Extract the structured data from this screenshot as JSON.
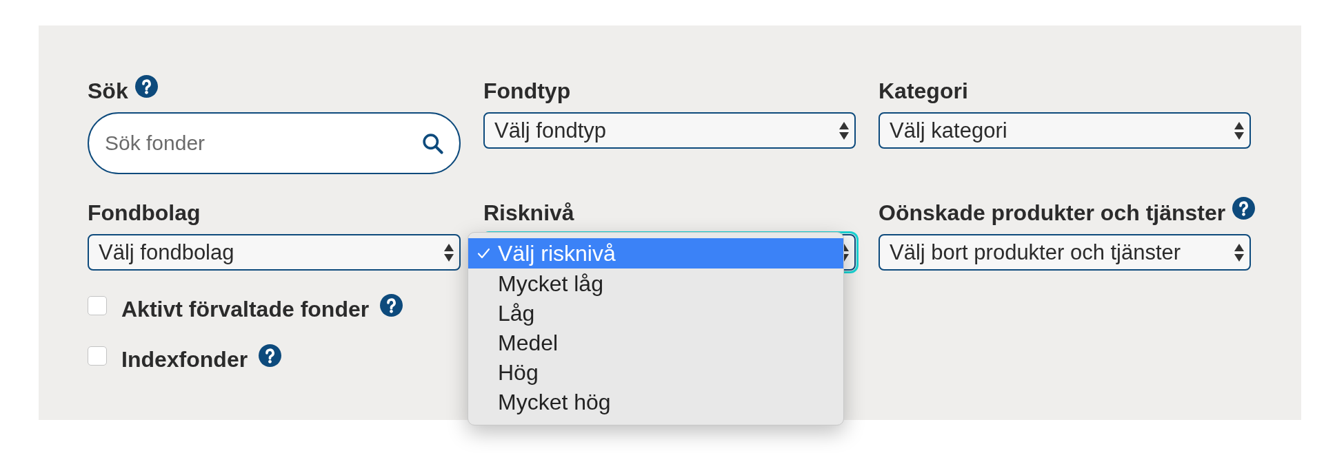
{
  "filters": [
    {
      "kind": "search",
      "label": "Sök",
      "help": true,
      "placeholder": "Sök fonder"
    },
    {
      "kind": "select",
      "label": "Fondtyp",
      "help": false,
      "value": "Välj fondtyp",
      "focused": false,
      "expanded": false
    },
    {
      "kind": "select",
      "label": "Kategori",
      "help": false,
      "value": "Välj kategori",
      "focused": false,
      "expanded": false
    },
    {
      "kind": "select",
      "label": "Fondbolag",
      "help": false,
      "value": "Välj fondbolag",
      "focused": false,
      "expanded": false
    },
    {
      "kind": "select",
      "label": "Risknivå",
      "help": false,
      "focused": true,
      "expanded": true,
      "options": [
        {
          "label": "Välj risknivå",
          "selected": true
        },
        {
          "label": "Mycket låg",
          "selected": false
        },
        {
          "label": "Låg",
          "selected": false
        },
        {
          "label": "Medel",
          "selected": false
        },
        {
          "label": "Hög",
          "selected": false
        },
        {
          "label": "Mycket hög",
          "selected": false
        }
      ]
    },
    {
      "kind": "select",
      "label": "Oönskade produkter och tjänster",
      "help": true,
      "value": "Välj bort produkter och tjänster",
      "focused": false,
      "expanded": false
    }
  ],
  "checkboxes": [
    {
      "label": "Aktivt förvaltade fonder",
      "checked": false,
      "help": true
    },
    {
      "label": "Indexfonder",
      "checked": false,
      "help": true
    }
  ]
}
